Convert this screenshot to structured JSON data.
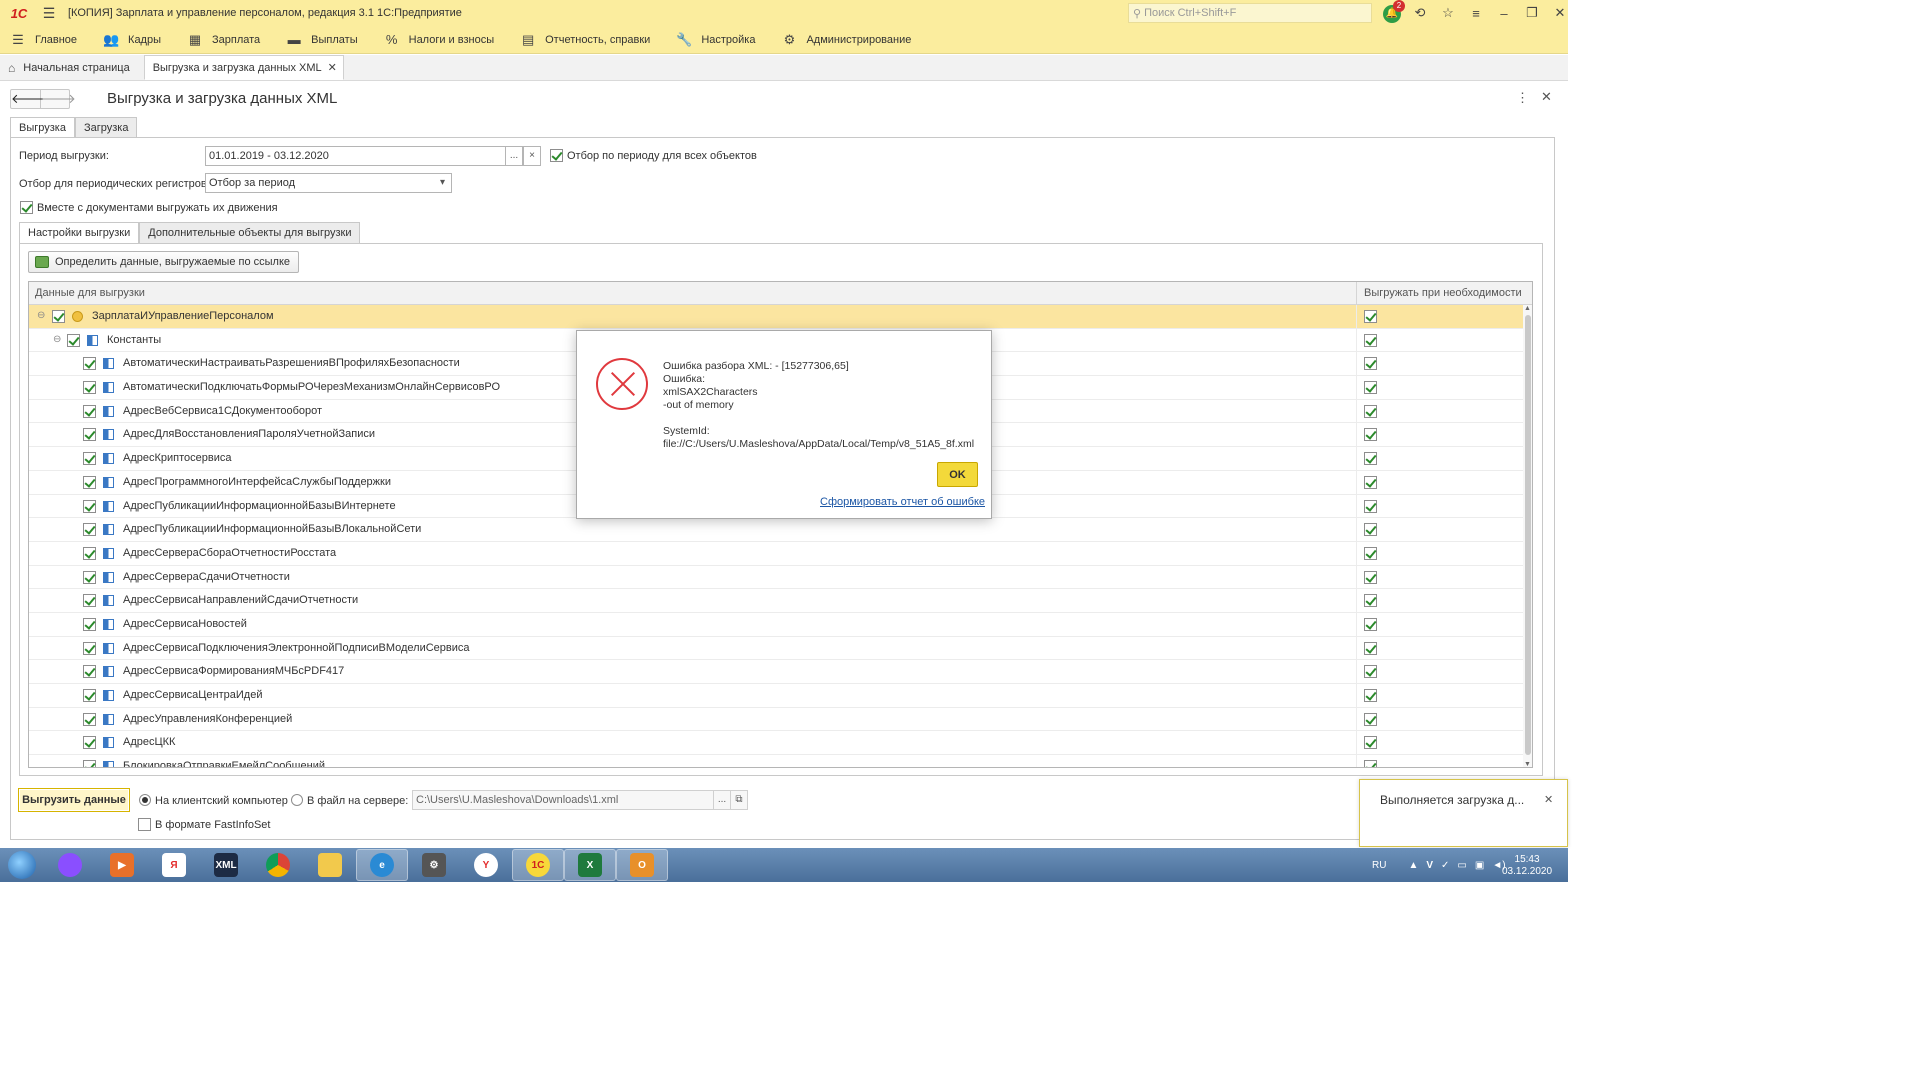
{
  "window": {
    "title": "[КОПИЯ] Зарплата и управление персоналом, редакция 3.1 1С:Предприятие",
    "search_placeholder": "Поиск Ctrl+Shift+F",
    "notifications_count": "2"
  },
  "menu": [
    "Главное",
    "Кадры",
    "Зарплата",
    "Выплаты",
    "Налоги и взносы",
    "Отчетность, справки",
    "Настройка",
    "Администрирование"
  ],
  "tabs": {
    "home": "Начальная страница",
    "current": "Выгрузка и загрузка данных XML"
  },
  "form": {
    "title": "Выгрузка и загрузка данных XML",
    "tab_export": "Выгрузка",
    "tab_import": "Загрузка",
    "period_label": "Период выгрузки:",
    "period_value": "01.01.2019 - 03.12.2020",
    "period_filter_all": "Отбор по периоду для всех объектов",
    "registers_label": "Отбор для периодических регистров:",
    "registers_value": "Отбор за период",
    "with_movements": "Вместе с документами выгружать их движения",
    "subtab_settings": "Настройки выгрузки",
    "subtab_additional": "Дополнительные объекты для выгрузки",
    "define_button": "Определить данные, выгружаемые по ссылке",
    "col_data": "Данные для выгрузки",
    "col_export_needed": "Выгружать при необходимости"
  },
  "tree": {
    "root": "ЗарплатаИУправлениеПерсоналом",
    "constants": "Константы",
    "items": [
      "АвтоматическиНастраиватьРазрешенияВПрофиляхБезопасности",
      "АвтоматическиПодключатьФормыРОЧерезМеханизмОнлайнСервисовРО",
      "АдресВебСервиса1СДокументооборот",
      "АдресДляВосстановленияПароляУчетнойЗаписи",
      "АдресКриптосервиса",
      "АдресПрограммногоИнтерфейсаСлужбыПоддержки",
      "АдресПубликацииИнформационнойБазыВИнтернете",
      "АдресПубликацииИнформационнойБазыВЛокальнойСети",
      "АдресСервераСбораОтчетностиРосстата",
      "АдресСервераСдачиОтчетности",
      "АдресСервисаНаправленийСдачиОтчетности",
      "АдресСервисаНовостей",
      "АдресСервисаПодключенияЭлектроннойПодписиВМоделиСервиса",
      "АдресСервисаФормированияМЧБсPDF417",
      "АдресСервисаЦентраИдей",
      "АдресУправленияКонференцией",
      "АдресЦКК",
      "БлокировкаОтправкиЕмейлСообщений"
    ]
  },
  "bottom": {
    "export_button": "Выгрузить данные",
    "to_client": "На клиентский компьютер",
    "to_server": "В файл на сервере:",
    "server_path": "C:\\Users\\U.Masleshova\\Downloads\\1.xml",
    "fast_infoset": "В формате FastInfoSet"
  },
  "dialog": {
    "line1": "Ошибка разбора XML:  - [15277306,65]",
    "line2": "Ошибка:",
    "line3": "xmlSAX2Characters",
    "line4": "-out of memory",
    "line5": "SystemId:",
    "line6": "file://C:/Users/U.Masleshova/AppData/Local/Temp/v8_51A5_8f.xml",
    "ok": "OK",
    "report_link": "Сформировать отчет об ошибке"
  },
  "toast": {
    "text": "Выполняется загрузка д..."
  },
  "taskbar": {
    "lang": "RU",
    "time": "15:43",
    "date": "03.12.2020",
    "xml_label": "XML",
    "onec_label": "1С"
  }
}
